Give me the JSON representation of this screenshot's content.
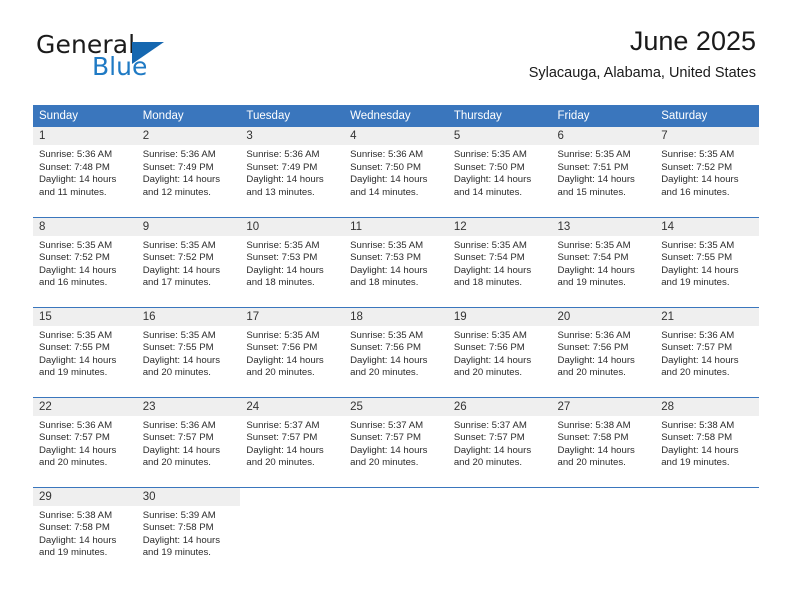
{
  "brand": {
    "name_top": "General",
    "name_bottom": "Blue",
    "accent_color": "#1567b0",
    "triangle_icon": "triangle-icon"
  },
  "header": {
    "title": "June 2025",
    "subtitle": "Sylacauga, Alabama, United States"
  },
  "theme": {
    "header_row_bg": "#3a76bd",
    "daynum_bg": "#efefef",
    "grid_line": "#3a76bd",
    "text": "#2b2b2b"
  },
  "calendar": {
    "weekday_headers": [
      "Sunday",
      "Monday",
      "Tuesday",
      "Wednesday",
      "Thursday",
      "Friday",
      "Saturday"
    ],
    "weeks": [
      [
        {
          "day": "1",
          "sunrise": "Sunrise: 5:36 AM",
          "sunset": "Sunset: 7:48 PM",
          "daylight_1": "Daylight: 14 hours",
          "daylight_2": "and 11 minutes."
        },
        {
          "day": "2",
          "sunrise": "Sunrise: 5:36 AM",
          "sunset": "Sunset: 7:49 PM",
          "daylight_1": "Daylight: 14 hours",
          "daylight_2": "and 12 minutes."
        },
        {
          "day": "3",
          "sunrise": "Sunrise: 5:36 AM",
          "sunset": "Sunset: 7:49 PM",
          "daylight_1": "Daylight: 14 hours",
          "daylight_2": "and 13 minutes."
        },
        {
          "day": "4",
          "sunrise": "Sunrise: 5:36 AM",
          "sunset": "Sunset: 7:50 PM",
          "daylight_1": "Daylight: 14 hours",
          "daylight_2": "and 14 minutes."
        },
        {
          "day": "5",
          "sunrise": "Sunrise: 5:35 AM",
          "sunset": "Sunset: 7:50 PM",
          "daylight_1": "Daylight: 14 hours",
          "daylight_2": "and 14 minutes."
        },
        {
          "day": "6",
          "sunrise": "Sunrise: 5:35 AM",
          "sunset": "Sunset: 7:51 PM",
          "daylight_1": "Daylight: 14 hours",
          "daylight_2": "and 15 minutes."
        },
        {
          "day": "7",
          "sunrise": "Sunrise: 5:35 AM",
          "sunset": "Sunset: 7:52 PM",
          "daylight_1": "Daylight: 14 hours",
          "daylight_2": "and 16 minutes."
        }
      ],
      [
        {
          "day": "8",
          "sunrise": "Sunrise: 5:35 AM",
          "sunset": "Sunset: 7:52 PM",
          "daylight_1": "Daylight: 14 hours",
          "daylight_2": "and 16 minutes."
        },
        {
          "day": "9",
          "sunrise": "Sunrise: 5:35 AM",
          "sunset": "Sunset: 7:52 PM",
          "daylight_1": "Daylight: 14 hours",
          "daylight_2": "and 17 minutes."
        },
        {
          "day": "10",
          "sunrise": "Sunrise: 5:35 AM",
          "sunset": "Sunset: 7:53 PM",
          "daylight_1": "Daylight: 14 hours",
          "daylight_2": "and 18 minutes."
        },
        {
          "day": "11",
          "sunrise": "Sunrise: 5:35 AM",
          "sunset": "Sunset: 7:53 PM",
          "daylight_1": "Daylight: 14 hours",
          "daylight_2": "and 18 minutes."
        },
        {
          "day": "12",
          "sunrise": "Sunrise: 5:35 AM",
          "sunset": "Sunset: 7:54 PM",
          "daylight_1": "Daylight: 14 hours",
          "daylight_2": "and 18 minutes."
        },
        {
          "day": "13",
          "sunrise": "Sunrise: 5:35 AM",
          "sunset": "Sunset: 7:54 PM",
          "daylight_1": "Daylight: 14 hours",
          "daylight_2": "and 19 minutes."
        },
        {
          "day": "14",
          "sunrise": "Sunrise: 5:35 AM",
          "sunset": "Sunset: 7:55 PM",
          "daylight_1": "Daylight: 14 hours",
          "daylight_2": "and 19 minutes."
        }
      ],
      [
        {
          "day": "15",
          "sunrise": "Sunrise: 5:35 AM",
          "sunset": "Sunset: 7:55 PM",
          "daylight_1": "Daylight: 14 hours",
          "daylight_2": "and 19 minutes."
        },
        {
          "day": "16",
          "sunrise": "Sunrise: 5:35 AM",
          "sunset": "Sunset: 7:55 PM",
          "daylight_1": "Daylight: 14 hours",
          "daylight_2": "and 20 minutes."
        },
        {
          "day": "17",
          "sunrise": "Sunrise: 5:35 AM",
          "sunset": "Sunset: 7:56 PM",
          "daylight_1": "Daylight: 14 hours",
          "daylight_2": "and 20 minutes."
        },
        {
          "day": "18",
          "sunrise": "Sunrise: 5:35 AM",
          "sunset": "Sunset: 7:56 PM",
          "daylight_1": "Daylight: 14 hours",
          "daylight_2": "and 20 minutes."
        },
        {
          "day": "19",
          "sunrise": "Sunrise: 5:35 AM",
          "sunset": "Sunset: 7:56 PM",
          "daylight_1": "Daylight: 14 hours",
          "daylight_2": "and 20 minutes."
        },
        {
          "day": "20",
          "sunrise": "Sunrise: 5:36 AM",
          "sunset": "Sunset: 7:56 PM",
          "daylight_1": "Daylight: 14 hours",
          "daylight_2": "and 20 minutes."
        },
        {
          "day": "21",
          "sunrise": "Sunrise: 5:36 AM",
          "sunset": "Sunset: 7:57 PM",
          "daylight_1": "Daylight: 14 hours",
          "daylight_2": "and 20 minutes."
        }
      ],
      [
        {
          "day": "22",
          "sunrise": "Sunrise: 5:36 AM",
          "sunset": "Sunset: 7:57 PM",
          "daylight_1": "Daylight: 14 hours",
          "daylight_2": "and 20 minutes."
        },
        {
          "day": "23",
          "sunrise": "Sunrise: 5:36 AM",
          "sunset": "Sunset: 7:57 PM",
          "daylight_1": "Daylight: 14 hours",
          "daylight_2": "and 20 minutes."
        },
        {
          "day": "24",
          "sunrise": "Sunrise: 5:37 AM",
          "sunset": "Sunset: 7:57 PM",
          "daylight_1": "Daylight: 14 hours",
          "daylight_2": "and 20 minutes."
        },
        {
          "day": "25",
          "sunrise": "Sunrise: 5:37 AM",
          "sunset": "Sunset: 7:57 PM",
          "daylight_1": "Daylight: 14 hours",
          "daylight_2": "and 20 minutes."
        },
        {
          "day": "26",
          "sunrise": "Sunrise: 5:37 AM",
          "sunset": "Sunset: 7:57 PM",
          "daylight_1": "Daylight: 14 hours",
          "daylight_2": "and 20 minutes."
        },
        {
          "day": "27",
          "sunrise": "Sunrise: 5:38 AM",
          "sunset": "Sunset: 7:58 PM",
          "daylight_1": "Daylight: 14 hours",
          "daylight_2": "and 20 minutes."
        },
        {
          "day": "28",
          "sunrise": "Sunrise: 5:38 AM",
          "sunset": "Sunset: 7:58 PM",
          "daylight_1": "Daylight: 14 hours",
          "daylight_2": "and 19 minutes."
        }
      ],
      [
        {
          "day": "29",
          "sunrise": "Sunrise: 5:38 AM",
          "sunset": "Sunset: 7:58 PM",
          "daylight_1": "Daylight: 14 hours",
          "daylight_2": "and 19 minutes."
        },
        {
          "day": "30",
          "sunrise": "Sunrise: 5:39 AM",
          "sunset": "Sunset: 7:58 PM",
          "daylight_1": "Daylight: 14 hours",
          "daylight_2": "and 19 minutes."
        },
        {
          "day": "",
          "sunrise": "",
          "sunset": "",
          "daylight_1": "",
          "daylight_2": ""
        },
        {
          "day": "",
          "sunrise": "",
          "sunset": "",
          "daylight_1": "",
          "daylight_2": ""
        },
        {
          "day": "",
          "sunrise": "",
          "sunset": "",
          "daylight_1": "",
          "daylight_2": ""
        },
        {
          "day": "",
          "sunrise": "",
          "sunset": "",
          "daylight_1": "",
          "daylight_2": ""
        },
        {
          "day": "",
          "sunrise": "",
          "sunset": "",
          "daylight_1": "",
          "daylight_2": ""
        }
      ]
    ]
  }
}
